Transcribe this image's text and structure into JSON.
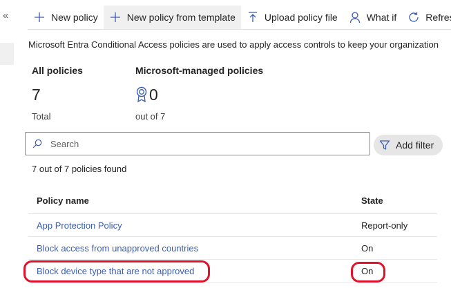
{
  "rail": {
    "collapse_glyph": "«"
  },
  "toolbar": {
    "items": [
      {
        "label": "New policy",
        "icon": "plus-icon"
      },
      {
        "label": "New policy from template",
        "icon": "plus-icon"
      },
      {
        "label": "Upload policy file",
        "icon": "upload-icon"
      },
      {
        "label": "What if",
        "icon": "person-icon"
      },
      {
        "label": "Refresh",
        "icon": "refresh-icon"
      }
    ]
  },
  "description": "Microsoft Entra Conditional Access policies are used to apply access controls to keep your organization",
  "stats": {
    "all": {
      "title": "All policies",
      "value": "7",
      "sub": "Total"
    },
    "managed": {
      "title": "Microsoft-managed policies",
      "value": "0",
      "sub": "out of 7",
      "icon": "award-icon"
    }
  },
  "search": {
    "placeholder": "Search",
    "value": ""
  },
  "filter": {
    "label": "Add filter"
  },
  "result_count": "7 out of 7 policies found",
  "table": {
    "headers": {
      "name": "Policy name",
      "state": "State"
    },
    "rows": [
      {
        "name": "App Protection Policy",
        "state": "Report-only"
      },
      {
        "name": "Block access from unapproved countries",
        "state": "On"
      },
      {
        "name": "Block device type that are not approved",
        "state": "On"
      }
    ]
  },
  "colors": {
    "link": "#3a5db0",
    "highlight": "#e0122b",
    "active_button_bg": "#f0f0f0"
  }
}
